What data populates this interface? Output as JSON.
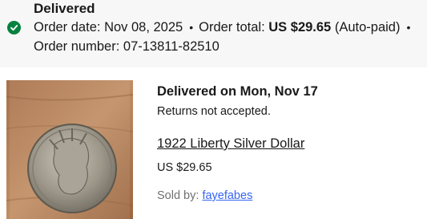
{
  "order": {
    "status": "Delivered",
    "order_date_label": "Order date:",
    "order_date": "Nov 08, 2025",
    "order_total_label": "Order total:",
    "order_total": "US $29.65",
    "payment_note": "(Auto-paid)",
    "separator": "•",
    "order_number_label": "Order number:",
    "order_number": "07-13811-82510",
    "status_color": "#05823f"
  },
  "item": {
    "delivery_status": "Delivered on Mon, Nov 17",
    "returns_policy": "Returns not accepted.",
    "title": "1922 Liberty Silver Dollar",
    "price": "US $29.65",
    "seller_label": "Sold by:",
    "seller_name": "fayefabes",
    "link_color": "#3665f3"
  },
  "icons": {
    "status": "check-circle-icon"
  }
}
